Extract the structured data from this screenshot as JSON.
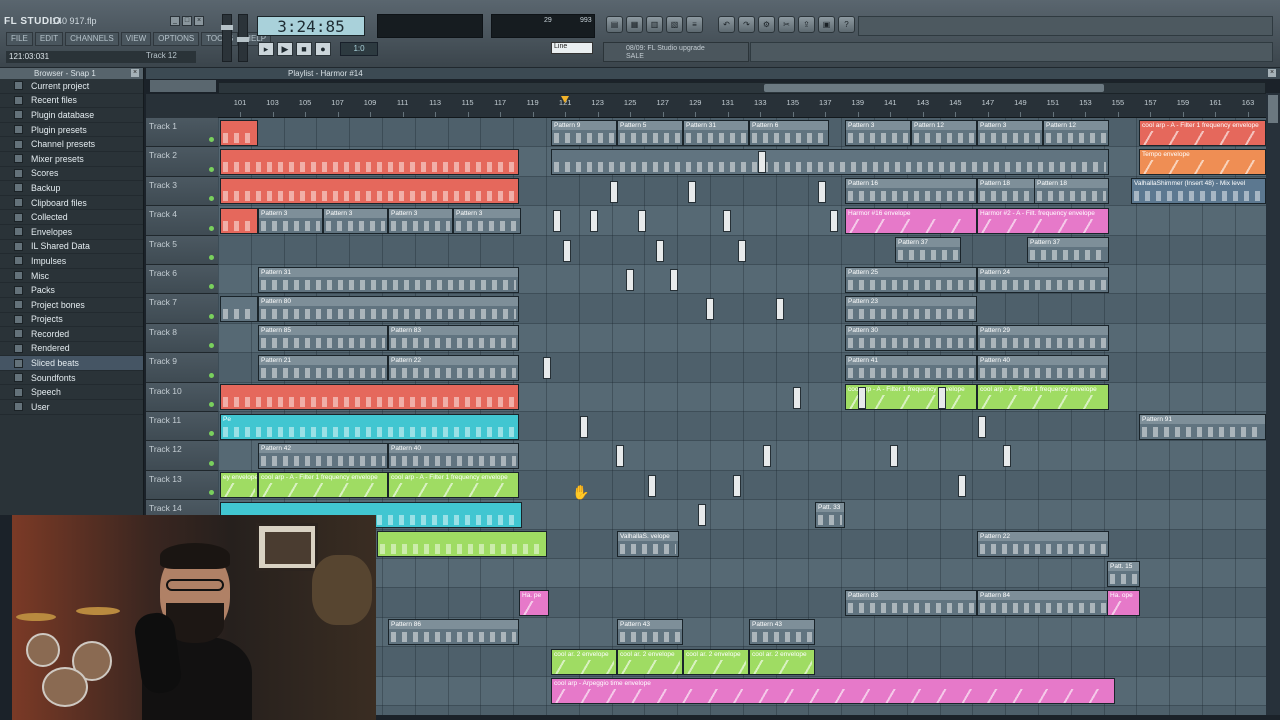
{
  "app": {
    "logo": "FL STUDIO",
    "filename": "140 917.flp",
    "menus": [
      "FILE",
      "EDIT",
      "CHANNELS",
      "VIEW",
      "OPTIONS",
      "TOOLS",
      "HELP"
    ],
    "hint_left": "121:03:031",
    "hint_right": "Track 12",
    "time": "3:24:85",
    "transport_mode": "1:0",
    "snap": "Line",
    "news_line1": "08/09: FL Studio upgrade",
    "news_line2": "SALE",
    "cpu_value": "29",
    "mem_value": "993"
  },
  "browser": {
    "title": "Browser - Snap 1",
    "items": [
      "Current project",
      "Recent files",
      "Plugin database",
      "Plugin presets",
      "Channel presets",
      "Mixer presets",
      "Scores",
      "Backup",
      "Clipboard files",
      "Collected",
      "Envelopes",
      "IL Shared Data",
      "Impulses",
      "Misc",
      "Packs",
      "Project bones",
      "Projects",
      "Recorded",
      "Rendered",
      "Sliced beats",
      "Soundfonts",
      "Speech",
      "User"
    ],
    "selected_index": 19
  },
  "playlist": {
    "title": "Playlist - Harmor #14",
    "bars": [
      "101",
      "103",
      "105",
      "107",
      "109",
      "111",
      "113",
      "115",
      "117",
      "119",
      "121",
      "123",
      "125",
      "127",
      "129",
      "131",
      "133",
      "135",
      "137",
      "139",
      "141",
      "143",
      "145",
      "147",
      "149",
      "151",
      "153",
      "155",
      "157",
      "159",
      "161",
      "163"
    ],
    "playhead_bar": 121,
    "tracks": [
      "Track 1",
      "Track 2",
      "Track 3",
      "Track 4",
      "Track 5",
      "Track 6",
      "Track 7",
      "Track 8",
      "Track 9",
      "Track 10",
      "Track 11",
      "Track 12",
      "Track 13",
      "Track 14"
    ],
    "clips": [
      {
        "row": 0,
        "start": 220,
        "len": 38,
        "color": "red",
        "label": ""
      },
      {
        "row": 0,
        "start": 551,
        "len": 66,
        "color": "pat",
        "label": "Pattern 9"
      },
      {
        "row": 0,
        "start": 617,
        "len": 66,
        "color": "pat",
        "label": "Pattern 5"
      },
      {
        "row": 0,
        "start": 683,
        "len": 66,
        "color": "pat",
        "label": "Pattern 31"
      },
      {
        "row": 0,
        "start": 749,
        "len": 80,
        "color": "pat",
        "label": "Pattern 6"
      },
      {
        "row": 0,
        "start": 845,
        "len": 66,
        "color": "pat",
        "label": "Pattern 3"
      },
      {
        "row": 0,
        "start": 911,
        "len": 66,
        "color": "pat",
        "label": "Pattern 12"
      },
      {
        "row": 0,
        "start": 977,
        "len": 66,
        "color": "pat",
        "label": "Pattern 3"
      },
      {
        "row": 0,
        "start": 1043,
        "len": 66,
        "color": "pat",
        "label": "Pattern 12"
      },
      {
        "row": 0,
        "start": 1139,
        "len": 127,
        "color": "red",
        "label": "cool arp - A - Filter 1 frequency envelope"
      },
      {
        "row": 1,
        "start": 220,
        "len": 299,
        "color": "red",
        "label": ""
      },
      {
        "row": 1,
        "start": 551,
        "len": 558,
        "color": "pat",
        "label": ""
      },
      {
        "row": 1,
        "start": 1139,
        "len": 127,
        "color": "orange",
        "label": "Tempo envelope"
      },
      {
        "row": 2,
        "start": 220,
        "len": 299,
        "color": "red",
        "label": ""
      },
      {
        "row": 2,
        "start": 845,
        "len": 132,
        "color": "pat",
        "label": "Pattern 16"
      },
      {
        "row": 2,
        "start": 977,
        "len": 66,
        "color": "pat",
        "label": "Pattern 18"
      },
      {
        "row": 2,
        "start": 1034,
        "len": 75,
        "color": "pat",
        "label": "Pattern 18"
      },
      {
        "row": 2,
        "start": 1131,
        "len": 135,
        "color": "blue",
        "label": "ValhallaShimmer (Insert 48) - Mix level"
      },
      {
        "row": 3,
        "start": 220,
        "len": 38,
        "color": "red",
        "label": ""
      },
      {
        "row": 3,
        "start": 258,
        "len": 65,
        "color": "pat",
        "label": "Pattern 3"
      },
      {
        "row": 3,
        "start": 323,
        "len": 65,
        "color": "pat",
        "label": "Pattern 3"
      },
      {
        "row": 3,
        "start": 388,
        "len": 65,
        "color": "pat",
        "label": "Pattern 3"
      },
      {
        "row": 3,
        "start": 453,
        "len": 68,
        "color": "pat",
        "label": "Pattern 3"
      },
      {
        "row": 3,
        "start": 845,
        "len": 132,
        "color": "pink",
        "label": "Harmor #16 envelope"
      },
      {
        "row": 3,
        "start": 977,
        "len": 132,
        "color": "pink",
        "label": "Harmor #2 - A - Filt. frequency envelope"
      },
      {
        "row": 4,
        "start": 895,
        "len": 66,
        "color": "pat",
        "label": "Pattern 37"
      },
      {
        "row": 4,
        "start": 1027,
        "len": 82,
        "color": "pat",
        "label": "Pattern 37"
      },
      {
        "row": 5,
        "start": 258,
        "len": 261,
        "color": "pat",
        "label": "Pattern 31"
      },
      {
        "row": 5,
        "start": 845,
        "len": 132,
        "color": "pat",
        "label": "Pattern 25"
      },
      {
        "row": 5,
        "start": 977,
        "len": 132,
        "color": "pat",
        "label": "Pattern 24"
      },
      {
        "row": 6,
        "start": 220,
        "len": 38,
        "color": "pat",
        "label": ""
      },
      {
        "row": 6,
        "start": 258,
        "len": 261,
        "color": "pat",
        "label": "Pattern 80"
      },
      {
        "row": 6,
        "start": 845,
        "len": 132,
        "color": "pat",
        "label": "Pattern 23"
      },
      {
        "row": 7,
        "start": 258,
        "len": 130,
        "color": "pat",
        "label": "Pattern 85"
      },
      {
        "row": 7,
        "start": 388,
        "len": 131,
        "color": "pat",
        "label": "Pattern 83"
      },
      {
        "row": 7,
        "start": 845,
        "len": 132,
        "color": "pat",
        "label": "Pattern 30"
      },
      {
        "row": 7,
        "start": 977,
        "len": 132,
        "color": "pat",
        "label": "Pattern 29"
      },
      {
        "row": 8,
        "start": 258,
        "len": 130,
        "color": "pat",
        "label": "Pattern 21"
      },
      {
        "row": 8,
        "start": 388,
        "len": 131,
        "color": "pat",
        "label": "Pattern 22"
      },
      {
        "row": 8,
        "start": 845,
        "len": 132,
        "color": "pat",
        "label": "Pattern 41"
      },
      {
        "row": 8,
        "start": 977,
        "len": 132,
        "color": "pat",
        "label": "Pattern 40"
      },
      {
        "row": 9,
        "start": 220,
        "len": 299,
        "color": "red",
        "label": ""
      },
      {
        "row": 9,
        "start": 845,
        "len": 132,
        "color": "green",
        "label": "cool arp - A - Filter 1 frequency envelope"
      },
      {
        "row": 9,
        "start": 977,
        "len": 132,
        "color": "green",
        "label": "cool arp - A - Filter 1 frequency envelope"
      },
      {
        "row": 10,
        "start": 220,
        "len": 299,
        "color": "cyan",
        "label": "Pe"
      },
      {
        "row": 10,
        "start": 1139,
        "len": 127,
        "color": "pat",
        "label": "Pattern 91"
      },
      {
        "row": 11,
        "start": 258,
        "len": 130,
        "color": "pat",
        "label": "Pattern 42"
      },
      {
        "row": 11,
        "start": 388,
        "len": 131,
        "color": "pat",
        "label": "Pattern 40"
      },
      {
        "row": 12,
        "start": 220,
        "len": 38,
        "color": "green",
        "label": "ey envelope"
      },
      {
        "row": 12,
        "start": 258,
        "len": 130,
        "color": "green",
        "label": "cool arp - A - Filter 1 frequency envelope"
      },
      {
        "row": 12,
        "start": 388,
        "len": 131,
        "color": "green",
        "label": "cool arp - A - Filter 1 frequency envelope"
      },
      {
        "row": 13,
        "start": 220,
        "len": 302,
        "color": "cyan",
        "label": ""
      },
      {
        "row": 13,
        "start": 815,
        "len": 30,
        "color": "pat",
        "label": "Patt. 33"
      },
      {
        "row": 14,
        "start": 377,
        "len": 170,
        "color": "green",
        "label": ""
      },
      {
        "row": 14,
        "start": 617,
        "len": 62,
        "color": "pat",
        "label": "ValhallaS. velope"
      },
      {
        "row": 14,
        "start": 977,
        "len": 132,
        "color": "pat",
        "label": "Pattern 22"
      },
      {
        "row": 15,
        "start": 1107,
        "len": 33,
        "color": "pat",
        "label": "Patt. 15"
      },
      {
        "row": 16,
        "start": 519,
        "len": 30,
        "color": "pink",
        "label": "Ha. pe"
      },
      {
        "row": 16,
        "start": 845,
        "len": 132,
        "color": "pat",
        "label": "Pattern 83"
      },
      {
        "row": 16,
        "start": 977,
        "len": 132,
        "color": "pat",
        "label": "Pattern 84"
      },
      {
        "row": 16,
        "start": 1107,
        "len": 33,
        "color": "pink",
        "label": "Ha. ope"
      },
      {
        "row": 17,
        "start": 388,
        "len": 131,
        "color": "pat",
        "label": "Pattern 86"
      },
      {
        "row": 17,
        "start": 617,
        "len": 66,
        "color": "pat",
        "label": "Pattern 43"
      },
      {
        "row": 17,
        "start": 749,
        "len": 66,
        "color": "pat",
        "label": "Pattern 43"
      },
      {
        "row": 18,
        "start": 551,
        "len": 66,
        "color": "green",
        "label": "cool ar. 2 envelope"
      },
      {
        "row": 18,
        "start": 617,
        "len": 66,
        "color": "green",
        "label": "cool ar. 2 envelope"
      },
      {
        "row": 18,
        "start": 683,
        "len": 66,
        "color": "green",
        "label": "cool ar. 2 envelope"
      },
      {
        "row": 18,
        "start": 749,
        "len": 66,
        "color": "green",
        "label": "cool ar. 2 envelope"
      },
      {
        "row": 19,
        "start": 551,
        "len": 564,
        "color": "pink",
        "label": "cool arp - Arpeggio time envelope"
      }
    ]
  }
}
